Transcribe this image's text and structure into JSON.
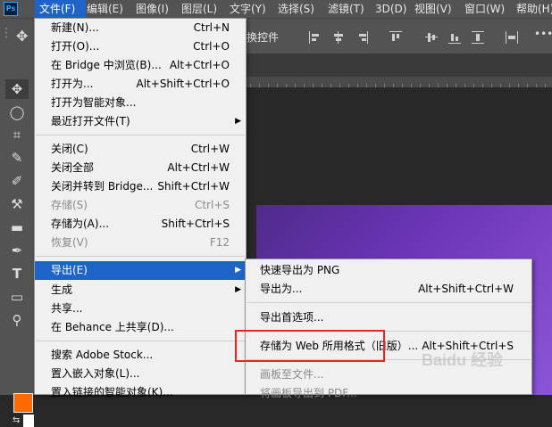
{
  "app": {
    "logo": "Ps"
  },
  "menubar": [
    {
      "label": "文件(F)",
      "active": true
    },
    {
      "label": "编辑(E)"
    },
    {
      "label": "图像(I)"
    },
    {
      "label": "图层(L)"
    },
    {
      "label": "文字(Y)"
    },
    {
      "label": "选择(S)"
    },
    {
      "label": "滤镜(T)"
    },
    {
      "label": "3D(D)"
    },
    {
      "label": "视图(V)"
    },
    {
      "label": "窗口(W)"
    },
    {
      "label": "帮助(H)"
    }
  ],
  "options_bar": {
    "transform_controls_label": "换控件",
    "more": "•••"
  },
  "tools": [
    "move-icon",
    "lasso-icon",
    "crop-icon",
    "eyedropper-icon",
    "brush-icon",
    "clone-stamp-icon",
    "gradient-icon",
    "pen-icon",
    "type-icon",
    "rectangle-icon",
    "zoom-icon"
  ],
  "colors": {
    "foreground": "#ff6a00",
    "background": "#ffffff",
    "menu_selection": "#1e64c8",
    "highlight_border": "#e8261f"
  },
  "file_menu": {
    "items": [
      {
        "label": "新建(N)...",
        "shortcut": "Ctrl+N"
      },
      {
        "label": "打开(O)...",
        "shortcut": "Ctrl+O"
      },
      {
        "label": "在 Bridge 中浏览(B)...",
        "shortcut": "Alt+Ctrl+O"
      },
      {
        "label": "打开为...",
        "shortcut": "Alt+Shift+Ctrl+O"
      },
      {
        "label": "打开为智能对象...",
        "shortcut": ""
      },
      {
        "label": "最近打开文件(T)",
        "shortcut": "",
        "submenu": true
      },
      {
        "label": "关闭(C)",
        "shortcut": "Ctrl+W"
      },
      {
        "label": "关闭全部",
        "shortcut": "Alt+Ctrl+W"
      },
      {
        "label": "关闭并转到 Bridge...",
        "shortcut": "Shift+Ctrl+W"
      },
      {
        "label": "存储(S)",
        "shortcut": "Ctrl+S",
        "disabled": true
      },
      {
        "label": "存储为(A)...",
        "shortcut": "Shift+Ctrl+S"
      },
      {
        "label": "恢复(V)",
        "shortcut": "F12",
        "disabled": true
      },
      {
        "label": "导出(E)",
        "shortcut": "",
        "submenu": true,
        "selected": true
      },
      {
        "label": "生成",
        "shortcut": "",
        "submenu": true
      },
      {
        "label": "共享...",
        "shortcut": ""
      },
      {
        "label": "在 Behance 上共享(D)...",
        "shortcut": ""
      },
      {
        "label": "搜索 Adobe Stock...",
        "shortcut": ""
      },
      {
        "label": "置入嵌入对象(L)...",
        "shortcut": ""
      },
      {
        "label": "置入链接的智能对象(K)...",
        "shortcut": ""
      }
    ]
  },
  "export_submenu": {
    "items": [
      {
        "label": "快速导出为 PNG",
        "shortcut": ""
      },
      {
        "label": "导出为...",
        "shortcut": "Alt+Shift+Ctrl+W"
      },
      {
        "label": "导出首选项...",
        "shortcut": ""
      },
      {
        "label": "存储为 Web 所用格式（旧版）...",
        "shortcut": "Alt+Shift+Ctrl+S"
      },
      {
        "label": "画板至文件...",
        "shortcut": "",
        "disabled": true
      },
      {
        "label": "将画板导出到 PDF...",
        "shortcut": "",
        "disabled": true
      }
    ]
  },
  "watermark": "Baidu 经验"
}
